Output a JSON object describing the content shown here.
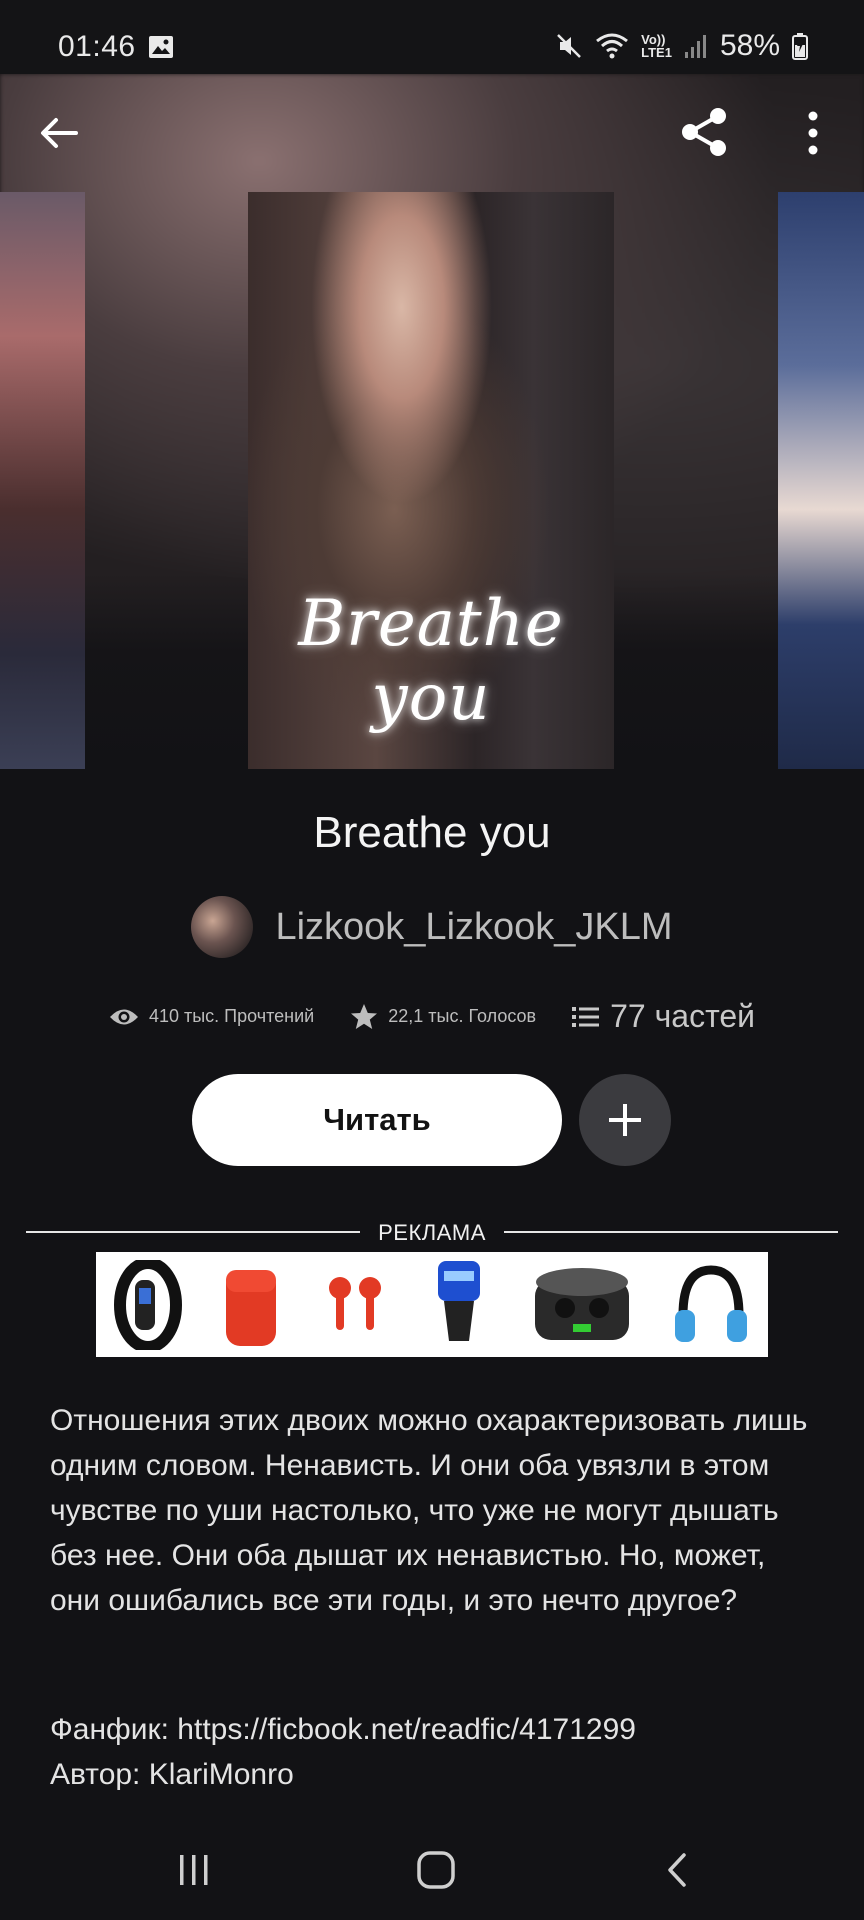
{
  "status_bar": {
    "time": "01:46",
    "battery": "58%",
    "icons": [
      "gallery-icon",
      "mute-icon",
      "wifi-icon",
      "volte-icon",
      "signal-icon",
      "battery-icon"
    ],
    "volte_text_top": "Vo))",
    "volte_text_bottom": "LTE1"
  },
  "hero": {
    "cover_title": "Breathe you"
  },
  "book": {
    "title": "Breathe you",
    "author": "Lizkook_Lizkook_JKLM"
  },
  "stats": {
    "reads": "410 тыс. Прочтений",
    "votes": "22,1 тыс. Голосов",
    "parts": "77 частей"
  },
  "actions": {
    "read_label": "Читать"
  },
  "ad": {
    "label": "РЕКЛАМА",
    "items": [
      "fitness-band-icon",
      "earbuds-case-icon",
      "earbuds-icon",
      "car-charger-icon",
      "wireless-earbuds-case-icon",
      "headphones-icon"
    ]
  },
  "description": {
    "text": "Отношения этих двоих можно охарактеризовать лишь одним словом. Ненависть. И они оба увязли в этом чувстве по уши настолько, что уже не могут дышать без нее. Они оба дышат их ненавистью. Но, может, они ошибались все эти годы, и это нечто другое?",
    "fanfic": "Фанфик: https://ficbook.net/readfic/4171299",
    "author_credit": "Автор: KlariMonro"
  },
  "colors": {
    "background": "#121215",
    "read_button_bg": "#ffffff",
    "add_button_bg": "#3b3b3f",
    "secondary_text": "#bdbdbd"
  }
}
